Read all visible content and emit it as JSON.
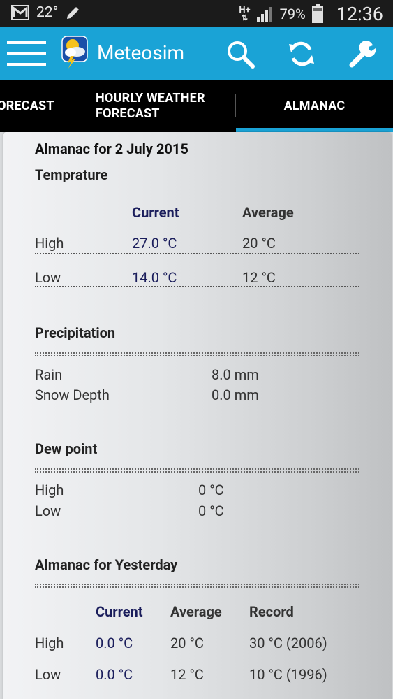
{
  "status_bar": {
    "temperature": "22°",
    "network": "H+",
    "battery": "79%",
    "time": "12:36"
  },
  "app": {
    "title": "Meteosim"
  },
  "tabs": [
    {
      "label": "FORECAST"
    },
    {
      "label_line1": "HOURLY WEATHER",
      "label_line2": "FORECAST"
    },
    {
      "label": "ALMANAC",
      "active": true
    }
  ],
  "almanac": {
    "title": "Almanac for 2 July 2015",
    "temperature": {
      "heading": "Temprature",
      "col_current": "Current",
      "col_average": "Average",
      "rows": [
        {
          "label": "High",
          "current": "27.0 °C",
          "average": "20 °C"
        },
        {
          "label": "Low",
          "current": "14.0 °C",
          "average": "12 °C"
        }
      ]
    },
    "precipitation": {
      "heading": "Precipitation",
      "rows": [
        {
          "label": "Rain",
          "value": "8.0 mm"
        },
        {
          "label": "Snow Depth",
          "value": "0.0 mm"
        }
      ]
    },
    "dew_point": {
      "heading": "Dew point",
      "rows": [
        {
          "label": "High",
          "value": "0 °C"
        },
        {
          "label": "Low",
          "value": "0 °C"
        }
      ]
    },
    "yesterday": {
      "heading": "Almanac for Yesterday",
      "col_current": "Current",
      "col_average": "Average",
      "col_record": "Record",
      "rows": [
        {
          "label": "High",
          "current": "0.0 °C",
          "average": "20 °C",
          "record": "30 °C (2006)"
        },
        {
          "label": "Low",
          "current": "0.0 °C",
          "average": "12 °C",
          "record": "10 °C (1996)"
        }
      ]
    }
  },
  "colors": {
    "accent": "#1aa3d6",
    "status_bar": "#1b1b1b",
    "tabs_bg": "#000000",
    "current_value": "#1b1e5c"
  }
}
